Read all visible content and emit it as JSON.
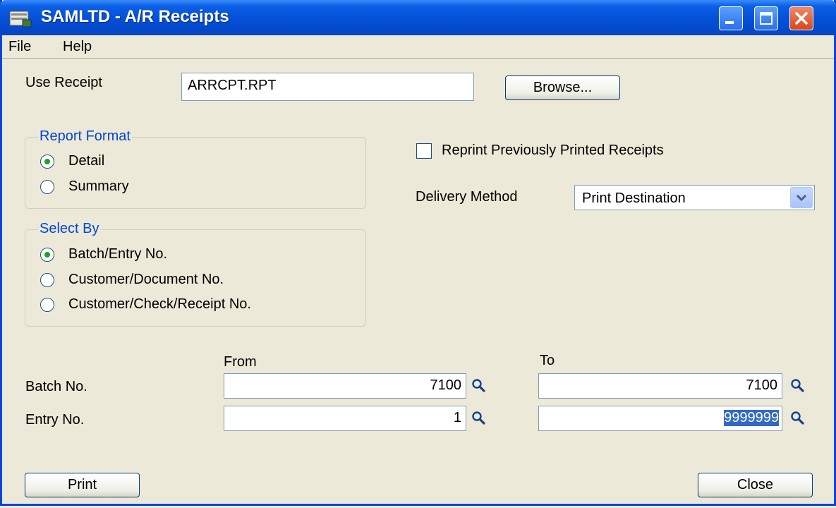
{
  "window": {
    "title": "SAMLTD - A/R Receipts"
  },
  "menu": {
    "file": "File",
    "help": "Help"
  },
  "use_receipt": {
    "label": "Use Receipt",
    "value": "ARRCPT.RPT",
    "browse_label": "Browse..."
  },
  "report_format": {
    "title": "Report Format",
    "options": [
      {
        "label": "Detail",
        "selected": true
      },
      {
        "label": "Summary",
        "selected": false
      }
    ]
  },
  "reprint": {
    "label": "Reprint Previously Printed Receipts",
    "checked": false
  },
  "delivery": {
    "label": "Delivery Method",
    "value": "Print Destination"
  },
  "select_by": {
    "title": "Select By",
    "options": [
      {
        "label": "Batch/Entry No.",
        "selected": true
      },
      {
        "label": "Customer/Document No.",
        "selected": false
      },
      {
        "label": "Customer/Check/Receipt No.",
        "selected": false
      }
    ]
  },
  "range": {
    "from_label": "From",
    "to_label": "To",
    "batch_label": "Batch No.",
    "entry_label": "Entry No.",
    "batch_from": "7100",
    "batch_to": "7100",
    "entry_from": "1",
    "entry_to": "9999999"
  },
  "buttons": {
    "print": "Print",
    "close": "Close"
  },
  "colors": {
    "titlebar": "#0450d8",
    "group_title": "#0046d5",
    "face": "#ece9d8",
    "radio_dot": "#21a121"
  },
  "icons": {
    "finder": "magnifier-icon",
    "dropdown": "chevron-down-icon"
  }
}
